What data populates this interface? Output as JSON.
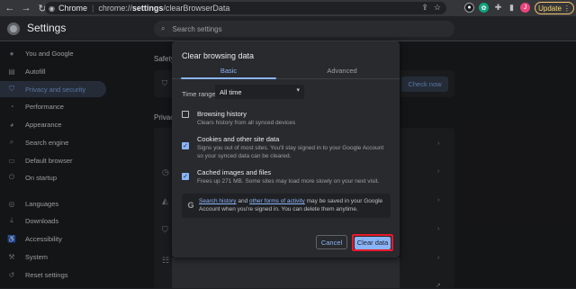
{
  "browser": {
    "tab_site": "Chrome",
    "url_prefix": "chrome://",
    "url_bold": "settings",
    "url_rest": "/clearBrowserData",
    "update_label": "Update",
    "profile_initial": "J"
  },
  "header": {
    "title": "Settings",
    "search_placeholder": "Search settings"
  },
  "sidebar": {
    "items": [
      {
        "label": "You and Google",
        "icon": "person-icon"
      },
      {
        "label": "Autofill",
        "icon": "autofill-icon"
      },
      {
        "label": "Privacy and security",
        "icon": "shield-icon",
        "active": true
      },
      {
        "label": "Performance",
        "icon": "speedometer-icon"
      },
      {
        "label": "Appearance",
        "icon": "palette-icon"
      },
      {
        "label": "Search engine",
        "icon": "search-icon"
      },
      {
        "label": "Default browser",
        "icon": "browser-icon"
      },
      {
        "label": "On startup",
        "icon": "power-icon"
      },
      {
        "label": "Languages",
        "icon": "globe-icon"
      },
      {
        "label": "Downloads",
        "icon": "download-icon"
      },
      {
        "label": "Accessibility",
        "icon": "accessibility-icon"
      },
      {
        "label": "System",
        "icon": "wrench-icon"
      },
      {
        "label": "Reset settings",
        "icon": "reset-icon"
      }
    ]
  },
  "main": {
    "safety_label": "Safety",
    "privacy_label": "Privacy",
    "check_now_label": "Check now"
  },
  "dialog": {
    "title": "Clear browsing data",
    "tabs": [
      "Basic",
      "Advanced"
    ],
    "time_range_label": "Time range",
    "time_range_value": "All time",
    "options": [
      {
        "title": "Browsing history",
        "desc": "Clears history from all synced devices",
        "checked": false
      },
      {
        "title": "Cookies and other site data",
        "desc": "Signs you out of most sites. You'll stay signed in to your Google Account so your synced data can be cleared.",
        "checked": true
      },
      {
        "title": "Cached images and files",
        "desc": "Frees up 271 MB. Some sites may load more slowly on your next visit.",
        "checked": true
      }
    ],
    "info": {
      "link1": "Search history",
      "and": " and ",
      "link2": "other forms of activity",
      "rest": " may be saved in your Google Account when you're signed in. You can delete them anytime."
    },
    "cancel_label": "Cancel",
    "clear_label": "Clear data"
  },
  "colors": {
    "accent": "#8ab4f8",
    "highlight_border": "#e8192c",
    "background": "#202124",
    "dialog_bg": "#292a2d"
  }
}
